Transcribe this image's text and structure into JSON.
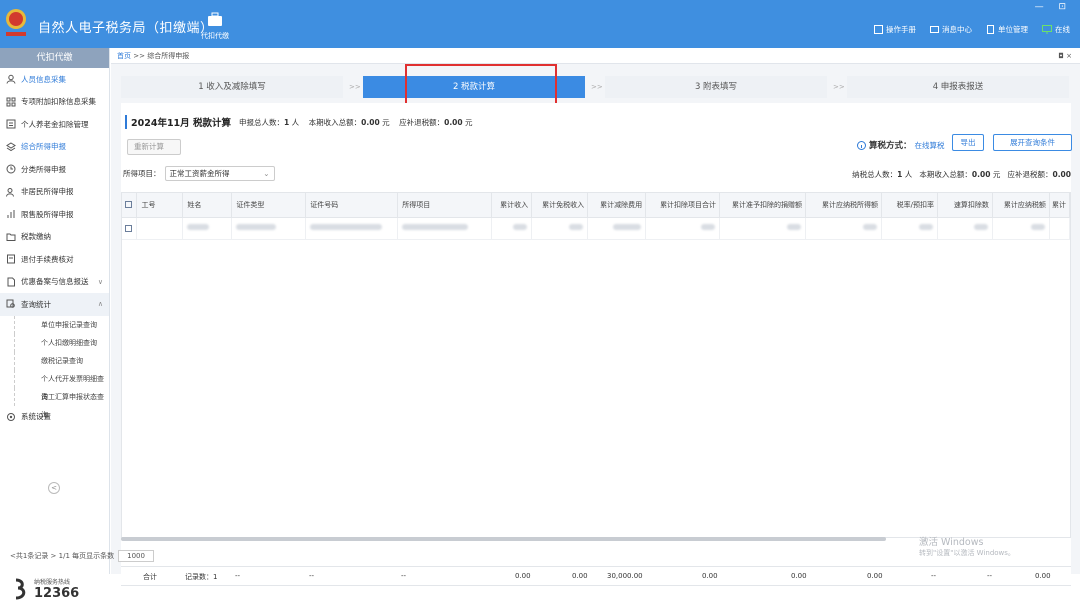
{
  "app": {
    "title": "自然人电子税务局（扣缴端）",
    "tool_label": "代扣代缴",
    "window_controls": "— ⊡"
  },
  "top_links": [
    {
      "icon": "manual-icon",
      "label": "操作手册"
    },
    {
      "icon": "message-icon",
      "label": "消息中心"
    },
    {
      "icon": "building-icon",
      "label": "单位管理"
    },
    {
      "icon": "monitor-icon",
      "label": "在线"
    }
  ],
  "sidebar": {
    "header": "代扣代缴",
    "items": [
      {
        "label": "人员信息采集",
        "icon": "person-icon",
        "active": true
      },
      {
        "label": "专项附加扣除信息采集",
        "icon": "grid-icon"
      },
      {
        "label": "个人养老金扣除管理",
        "icon": "list-icon"
      },
      {
        "label": "综合所得申报",
        "icon": "layers-icon",
        "active": true
      },
      {
        "label": "分类所得申报",
        "icon": "clock-icon"
      },
      {
        "label": "非居民所得申报",
        "icon": "person-plus-icon"
      },
      {
        "label": "限售股所得申报",
        "icon": "chart-icon"
      },
      {
        "label": "税款缴纳",
        "icon": "folder-icon"
      },
      {
        "label": "退付手续费核对",
        "icon": "doc-icon"
      },
      {
        "label": "优惠备案与信息报送",
        "icon": "file-icon",
        "arrow": "∨"
      },
      {
        "label": "查询统计",
        "icon": "search-doc-icon",
        "arrow": "∧",
        "open": true
      }
    ],
    "sub_items": [
      "单位申报记录查询",
      "个人扣缴明细查询",
      "缴税记录查询",
      "个人代开发票明细查询",
      "员工汇算申报状态查询"
    ],
    "settings": "系统设置",
    "collapse": "<",
    "hotline_label": "纳税服务热线",
    "hotline_number": "12366"
  },
  "breadcrumb": {
    "home": "首页",
    "sep": ">>",
    "current": "综合所得申报",
    "close": "◘ ×"
  },
  "steps": [
    {
      "label": "1 收入及减除填写"
    },
    {
      "label": "2 税款计算",
      "active": true
    },
    {
      "label": "3 附表填写"
    },
    {
      "label": "4 申报表报送"
    }
  ],
  "step_sep": ">>",
  "calc": {
    "period": "2024年11月  税款计算",
    "count_label": "申报总人数：",
    "count": "1",
    "count_unit": "人",
    "income_label": "本期收入总额：",
    "income": "0.00",
    "income_unit": "元",
    "tax_label": "应补退税额：",
    "tax": "0.00",
    "tax_unit": "元",
    "recalc": "重新计算",
    "method_label": "算税方式：",
    "method_value": "在线算税",
    "export": "导出",
    "expand": "展开查询条件",
    "filter_label": "所得项目：",
    "filter_value": "正常工资薪金所得",
    "right_count_label": "纳税总人数：",
    "right_count": "1",
    "right_count_unit": "人",
    "right_income_label": "本期收入总额：",
    "right_income": "0.00",
    "right_income_unit": "元",
    "right_tax_label": "应补退税额：",
    "right_tax": "0.00"
  },
  "table": {
    "headers": [
      "工号",
      "姓名",
      "证件类型",
      "证件号码",
      "所得项目",
      "累计收入",
      "累计免税收入",
      "累计减除费用",
      "累计扣除项目合计",
      "累计准予扣除的捐赠额",
      "累计应纳税所得额",
      "税率/预扣率",
      "速算扣除数",
      "累计应纳税额",
      "累计"
    ],
    "footer": {
      "label": "合计",
      "records": "记录数：1",
      "dash": "--",
      "income": "0.00",
      "exempt": "0.00",
      "deduct": "30,000.00",
      "items_total": "0.00",
      "donation": "0.00",
      "taxable": "0.00",
      "rate": "--",
      "quick": "--",
      "tax": "0.00"
    }
  },
  "pager": {
    "text": "<共1条记录 > 1/1  每页显示条数",
    "size": "1000"
  },
  "watermark": {
    "line1": "激活 Windows",
    "line2": "转到\"设置\"以激活 Windows。"
  }
}
